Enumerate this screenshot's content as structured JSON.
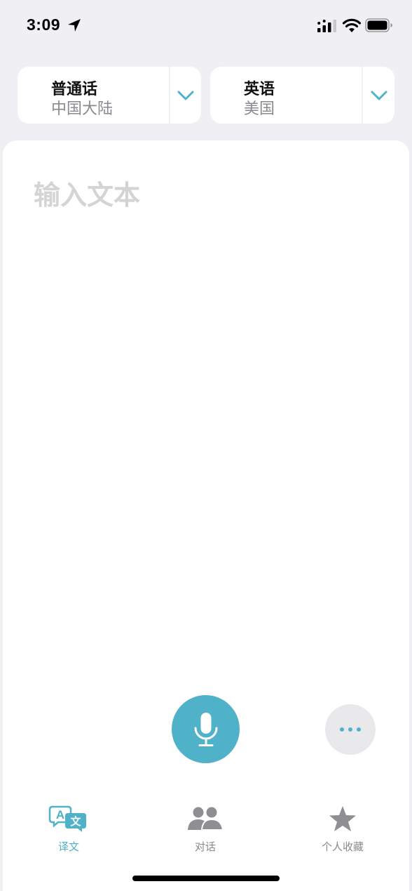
{
  "status_bar": {
    "time": "3:09",
    "icons": [
      "location-arrow-icon",
      "cellular-signal-icon",
      "wifi-icon",
      "battery-icon"
    ]
  },
  "source_language": {
    "name": "普通话",
    "region": "中国大陆",
    "icon": "chevron-down-icon"
  },
  "target_language": {
    "name": "英语",
    "region": "美国",
    "icon": "chevron-down-icon"
  },
  "input": {
    "value": "",
    "placeholder": "输入文本"
  },
  "actions": {
    "microphone_icon": "microphone-icon",
    "more_icon": "ellipsis-icon"
  },
  "tabs": [
    {
      "label": "译文",
      "icon": "translate-icon",
      "active": true
    },
    {
      "label": "对话",
      "icon": "conversation-icon",
      "active": false
    },
    {
      "label": "个人收藏",
      "icon": "star-icon",
      "active": false
    }
  ],
  "colors": {
    "accent": "#4fb2c9",
    "background": "#efeff4",
    "panel": "#ffffff",
    "secondary_text": "#8a8a8e",
    "placeholder": "#d4d4d6"
  }
}
